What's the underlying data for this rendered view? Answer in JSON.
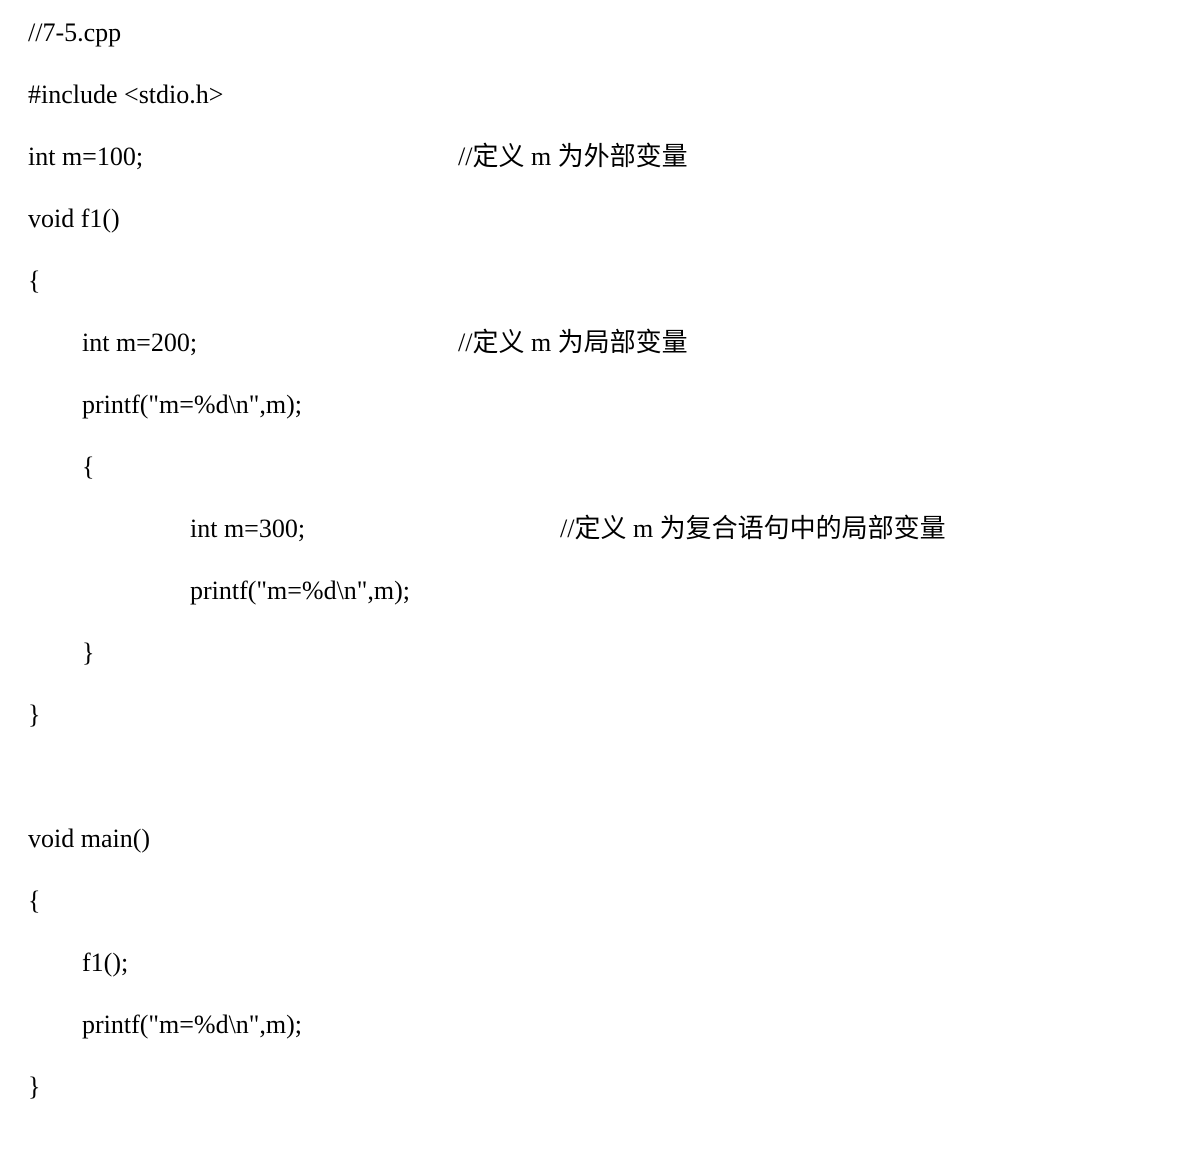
{
  "lines": [
    {
      "code": "//7-5.cpp",
      "comment": "",
      "indent": 0,
      "hasComment": false
    },
    {
      "code": "#include <stdio.h>",
      "comment": "",
      "indent": 0,
      "hasComment": false
    },
    {
      "code": "int m=100;",
      "comment": "//定义 m 为外部变量",
      "indent": 0,
      "hasComment": true
    },
    {
      "code": "void f1()",
      "comment": "",
      "indent": 0,
      "hasComment": false
    },
    {
      "code": "{",
      "comment": "",
      "indent": 0,
      "hasComment": false
    },
    {
      "code": "int m=200;",
      "comment": "//定义 m 为局部变量",
      "indent": 1,
      "hasComment": true
    },
    {
      "code": "printf(\"m=%d\\n\",m);",
      "comment": "",
      "indent": 1,
      "hasComment": false
    },
    {
      "code": "{",
      "comment": "",
      "indent": 1,
      "hasComment": false
    },
    {
      "code": "int m=300;",
      "comment": "//定义 m 为复合语句中的局部变量",
      "indent": 2,
      "hasComment": true
    },
    {
      "code": "printf(\"m=%d\\n\",m);",
      "comment": "",
      "indent": 2,
      "hasComment": false
    },
    {
      "code": "}",
      "comment": "",
      "indent": 1,
      "hasComment": false
    },
    {
      "code": "}",
      "comment": "",
      "indent": 0,
      "hasComment": false
    },
    {
      "code": "",
      "comment": "",
      "indent": 0,
      "hasComment": false,
      "blank": true
    },
    {
      "code": "void main()",
      "comment": "",
      "indent": 0,
      "hasComment": false
    },
    {
      "code": "{",
      "comment": "",
      "indent": 0,
      "hasComment": false
    },
    {
      "code": "f1();",
      "comment": "",
      "indent": 1,
      "hasComment": false
    },
    {
      "code": "printf(\"m=%d\\n\",m);",
      "comment": "",
      "indent": 1,
      "hasComment": false
    },
    {
      "code": "}",
      "comment": "",
      "indent": 0,
      "hasComment": false
    }
  ]
}
